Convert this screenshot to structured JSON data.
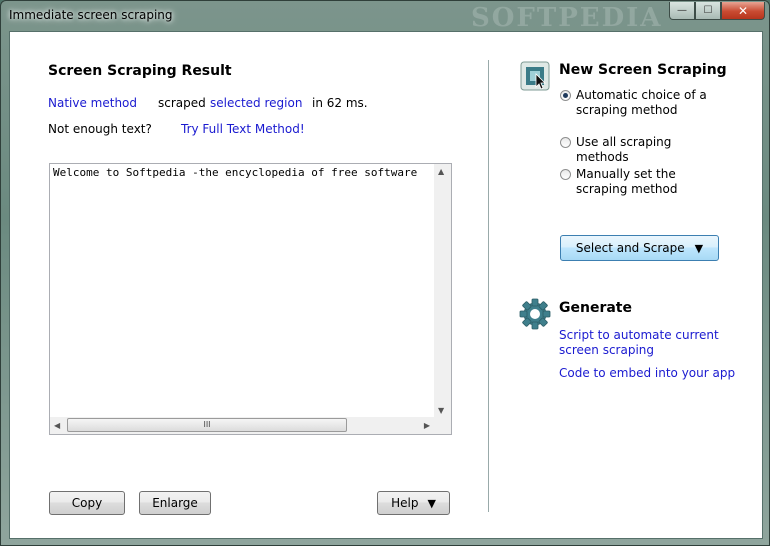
{
  "window": {
    "title": "Immediate screen scraping",
    "watermark": "SOFTPEDIA",
    "minimize_glyph": "—",
    "maximize_glyph": "☐",
    "close_glyph": "✕"
  },
  "result": {
    "heading": "Screen Scraping Result",
    "method_link": "Native method",
    "scraped_word": "scraped",
    "region_link": "selected region",
    "timing": "in 62 ms.",
    "not_enough": "Not enough text?",
    "full_text_link": "Try Full Text Method!",
    "text": "Welcome to Softpedia -the encyclopedia of free software",
    "thumb_grip": "III"
  },
  "buttons": {
    "copy": "Copy",
    "enlarge": "Enlarge",
    "help": "Help",
    "help_arrow": "▼",
    "select_scrape": "Select and Scrape",
    "select_arrow": "▼"
  },
  "new_scraping": {
    "heading": "New Screen Scraping",
    "options": [
      {
        "label": "Automatic choice of a scraping method",
        "checked": true
      },
      {
        "label": "Use all scraping methods",
        "checked": false
      },
      {
        "label": "Manually set the scraping method",
        "checked": false
      }
    ]
  },
  "generate": {
    "heading": "Generate",
    "link1": "Script to automate current screen scraping",
    "link2": "Code to embed into your app"
  },
  "colors": {
    "link": "#1a1ad0",
    "accent": "#3c7fb1"
  },
  "icons": [
    "screen-capture-icon",
    "gear-icon",
    "mouse-cursor-icon"
  ]
}
